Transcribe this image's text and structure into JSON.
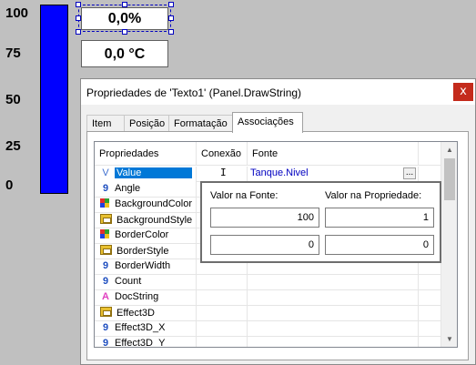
{
  "gauge": {
    "scale": [
      "100",
      "75",
      "50",
      "25",
      "0"
    ],
    "level_percent": 100,
    "bar_color": "#0000ff"
  },
  "display": {
    "percent_text": "0,0%",
    "temperature_text": "0,0 °C"
  },
  "dialog": {
    "title": "Propriedades de 'Texto1' (Panel.DrawString)",
    "close_glyph": "x",
    "tabs": [
      "Item",
      "Posição",
      "Formatação",
      "Associações"
    ],
    "active_tab": "Associações",
    "grid": {
      "headers": [
        "Propriedades",
        "Conexão",
        "Fonte"
      ],
      "rows": [
        {
          "icon": "variant-icon",
          "name": "Value",
          "source": "Tanque.Nivel"
        },
        {
          "icon": "number-icon",
          "name": "Angle",
          "source": ""
        },
        {
          "icon": "color-icon",
          "name": "BackgroundColor",
          "source": ""
        },
        {
          "icon": "enum-icon",
          "name": "BackgroundStyle",
          "source": ""
        },
        {
          "icon": "color-icon",
          "name": "BorderColor",
          "source": ""
        },
        {
          "icon": "enum-icon",
          "name": "BorderStyle",
          "source": ""
        },
        {
          "icon": "number-icon",
          "name": "BorderWidth",
          "source": ""
        },
        {
          "icon": "number-icon",
          "name": "Count",
          "source": ""
        },
        {
          "icon": "string-icon",
          "name": "DocString",
          "source": ""
        },
        {
          "icon": "enum-icon",
          "name": "Effect3D",
          "source": ""
        },
        {
          "icon": "number-icon",
          "name": "Effect3D_X",
          "source": ""
        },
        {
          "icon": "number-icon",
          "name": "Effect3D_Y",
          "source": ""
        }
      ],
      "ellipsis": "..."
    },
    "popup": {
      "source_label": "Valor na Fonte:",
      "property_label": "Valor na Propriedade:",
      "source_values": [
        "100",
        "0"
      ],
      "property_values": [
        "1",
        "0"
      ]
    }
  }
}
